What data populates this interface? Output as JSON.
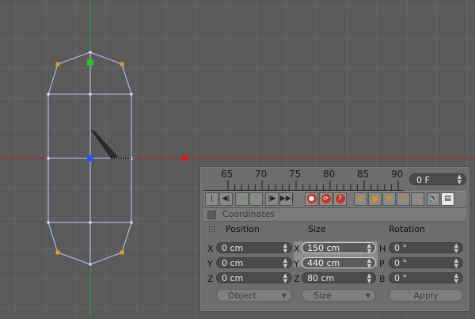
{
  "colors": {
    "viewport_bg": "#5a5a5a",
    "grid": "#666666",
    "x_axis": "#c81e1e",
    "y_axis": "#2fa52f",
    "wire": "#b8c8ff",
    "point": "#e59a2b",
    "handle_green": "#2dbd2d",
    "handle_blue": "#3250e6"
  },
  "timeline": {
    "ticks": [
      "65",
      "70",
      "75",
      "80",
      "85",
      "90"
    ],
    "current_frame": "0 F"
  },
  "transport": {
    "icons": [
      "go-to-start-icon",
      "step-back-icon",
      "play-backwards-icon",
      "play-forwards-icon",
      "step-forward-icon",
      "go-to-end-icon",
      "record-active-objects-icon",
      "autokeying-icon",
      "keyframe-selection-icon",
      "position-key-icon",
      "scale-key-icon",
      "rotation-key-icon",
      "parameter-key-icon",
      "point-level-key-icon",
      "sound-icon",
      "animation-layout-icon"
    ]
  },
  "coordinates": {
    "title": "Coordinates",
    "columns": [
      "Position",
      "Size",
      "Rotation"
    ],
    "position": [
      {
        "axis": "X",
        "value": "0 cm"
      },
      {
        "axis": "Y",
        "value": "0 cm"
      },
      {
        "axis": "Z",
        "value": "0 cm"
      }
    ],
    "size": [
      {
        "axis": "X",
        "value": "150 cm"
      },
      {
        "axis": "Y",
        "value": "440 cm"
      },
      {
        "axis": "Z",
        "value": "80 cm"
      }
    ],
    "rotation": [
      {
        "axis": "H",
        "value": "0 °"
      },
      {
        "axis": "P",
        "value": "0 °"
      },
      {
        "axis": "B",
        "value": "0 °"
      }
    ],
    "mode_dropdown": "Object",
    "size_dropdown": "Size",
    "apply_label": "Apply"
  }
}
